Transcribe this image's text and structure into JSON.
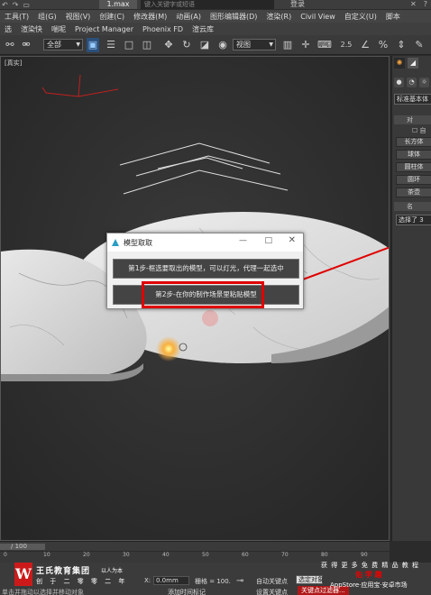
{
  "titlebar": {
    "file_tab": "1.max",
    "search_placeholder": "键入关键字或短语",
    "login": "登录"
  },
  "menu_row1": [
    "工具(T)",
    "组(G)",
    "视图(V)",
    "创建(C)",
    "修改器(M)",
    "动画(A)",
    "图形编辑器(D)",
    "渲染(R)",
    "Civil View",
    "自定义(U)",
    "脚本"
  ],
  "menu_row2": [
    "选",
    "渲染快",
    "喘呢",
    "Project Manager",
    "Phoenix FD",
    "渲云库"
  ],
  "toolbar": {
    "selection_filter": "全部",
    "reference_coord": "视图",
    "snap_value": "2.5"
  },
  "viewport": {
    "label": "[真实]"
  },
  "cmdpanel": {
    "category": "标准基本体",
    "rollout_object_type": "对",
    "auto_grid": "自",
    "primitives": [
      "长方体",
      "球体",
      "圆柱体",
      "圆环",
      "茶壶"
    ],
    "rollout_name": "名",
    "name_field": "选择了 3"
  },
  "dialog": {
    "title": "模型取取",
    "step1": "第1步-框选要取出的模型，可以灯光，代理一起选中",
    "step2": "第2步-在你的制作场景里粘贴模型",
    "min": "—",
    "max": "□",
    "close": "✕"
  },
  "timeline": {
    "frame_counter": "/ 100",
    "ticks": [
      "0",
      "10",
      "20",
      "30",
      "40",
      "50",
      "60",
      "70",
      "80",
      "90"
    ]
  },
  "status": {
    "line1": "自动关键点",
    "select_label": "选定对象",
    "set_key": "设置关键点",
    "key_filter": "关键点过滤器...",
    "x_label": "X:",
    "x_value": "0.0mm",
    "grid_label": "栅格 = 100.",
    "add_time_tag": "添加时间标记",
    "bottom_left": "单击并拖动以选择并移动对象"
  },
  "watermark": {
    "company": "王氏教育集团",
    "slogan": "以人为本",
    "slogan2": "创 于 二 零 零 二 年",
    "right_line1": "获 得 更 多 免 费 精 品 教 程",
    "right_brand": "佑 学 趣",
    "right_line3": "AppStore·应用宝·安卓市场"
  },
  "colors": {
    "highlight": "#e00000",
    "arrow": "#e00000",
    "marble": "#e6e6e6"
  }
}
